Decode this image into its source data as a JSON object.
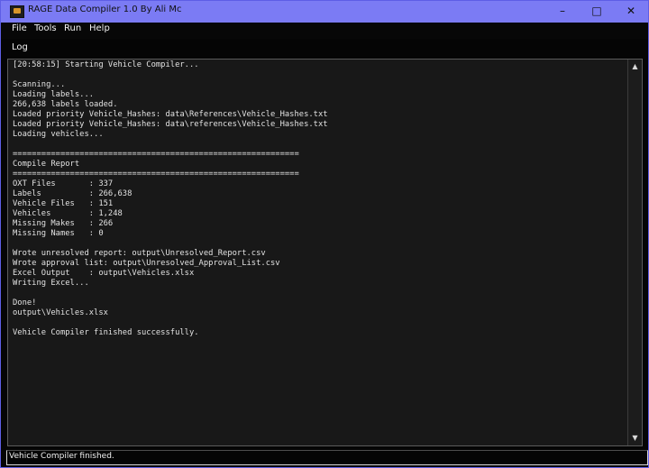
{
  "window": {
    "title": "RAGE Data Compiler 1.0 By Ali Mc",
    "controls": {
      "minimize": "–",
      "maximize": "□",
      "close": "✕"
    },
    "icons": {
      "app": "app-icon",
      "minimize": "minimize-icon",
      "maximize": "maximize-icon",
      "close": "close-icon"
    }
  },
  "menu": {
    "items": [
      "File",
      "Tools",
      "Run",
      "Help"
    ]
  },
  "log": {
    "label": "Log",
    "text": "[20:58:15] Starting Vehicle Compiler...\n\nScanning...\nLoading labels...\n266,638 labels loaded.\nLoaded priority Vehicle_Hashes: data\\References\\Vehicle_Hashes.txt\nLoaded priority Vehicle_Hashes: data\\references\\Vehicle_Hashes.txt\nLoading vehicles...\n\n============================================================\nCompile Report\n============================================================\nOXT Files       : 337\nLabels          : 266,638\nVehicle Files   : 151\nVehicles        : 1,248\nMissing Makes   : 266\nMissing Names   : 0\n\nWrote unresolved report: output\\Unresolved_Report.csv\nWrote approval list: output\\Unresolved_Approval_List.csv\nExcel Output    : output\\Vehicles.xlsx\nWriting Excel...\n\nDone!\noutput\\Vehicles.xlsx\n\nVehicle Compiler finished successfully."
  },
  "scrollbar": {
    "up": "▲",
    "down": "▼",
    "icons": {
      "up": "scroll-up-icon",
      "down": "scroll-down-icon"
    }
  },
  "status": {
    "text": "Vehicle Compiler finished."
  }
}
